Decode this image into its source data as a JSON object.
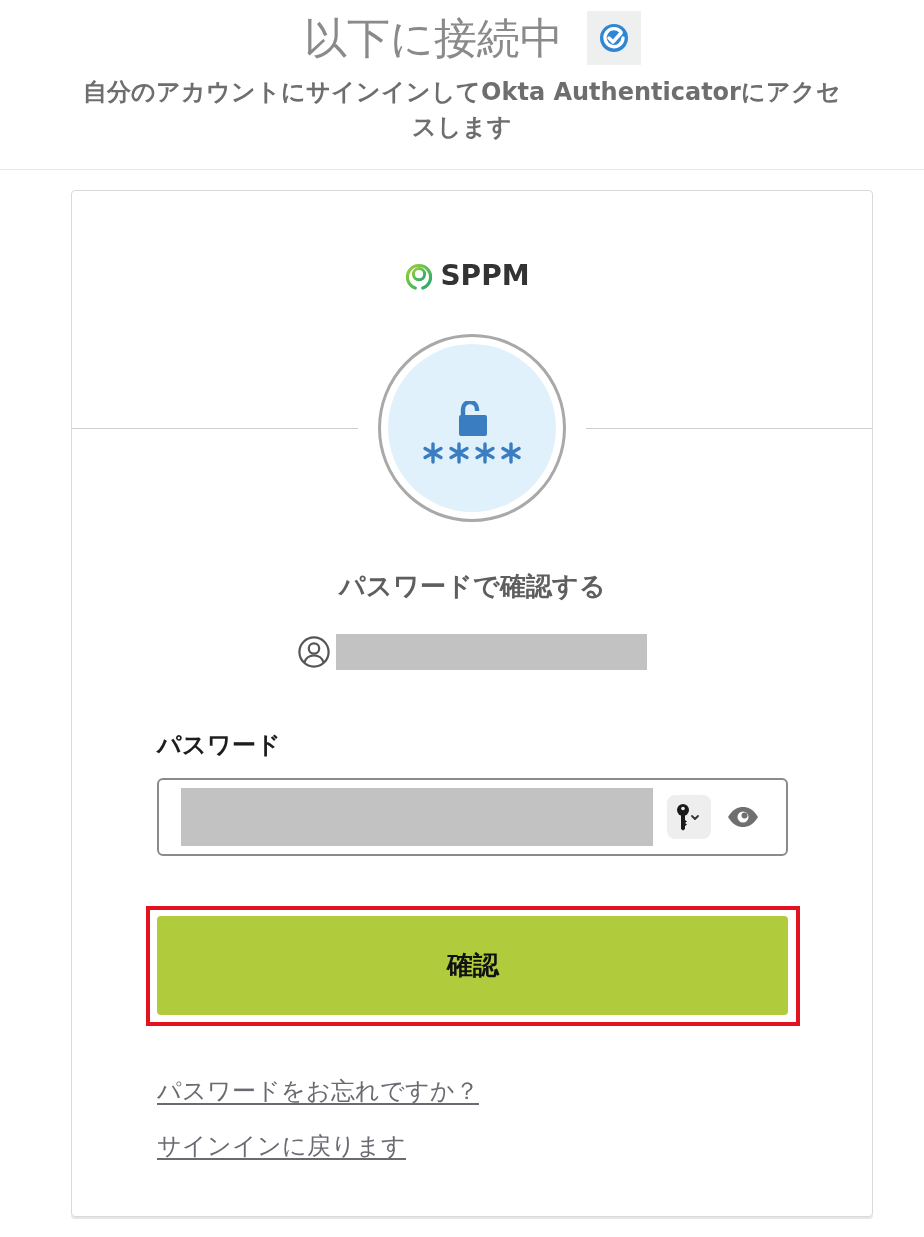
{
  "header": {
    "title": "以下に接続中",
    "subtitle": "自分のアカウントにサインインしてOkta Authenticatorにアクセスします"
  },
  "card": {
    "logo": "SPPM",
    "heading": "パスワードで確認する",
    "password": {
      "label": "パスワード"
    },
    "submit": {
      "label": "確認",
      "highlighted": true
    },
    "links": [
      "パスワードをお忘れですか？",
      "サインインに戻ります"
    ]
  }
}
